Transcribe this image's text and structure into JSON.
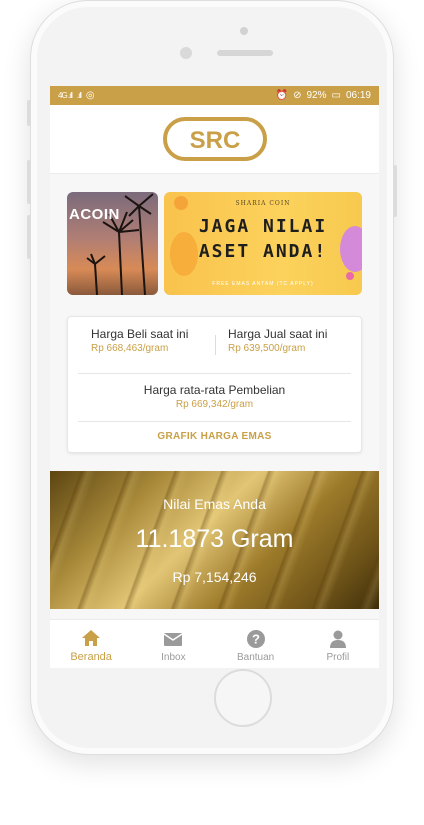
{
  "statusbar": {
    "signal1": "4G .ıll",
    "signal2": ".ıll",
    "battery": "92%",
    "time": "06:19"
  },
  "header": {
    "logo_text": "SRC"
  },
  "banners": {
    "banner1_text": "ACOIN",
    "banner2_small": "SHARIA COIN",
    "banner2_title_line1": "JAGA NILAI",
    "banner2_title_line2": "ASET ANDA!",
    "banner2_footer": "FREE EMAS ANTAM (TC APPLY)"
  },
  "price_card": {
    "buy_label": "Harga Beli saat ini",
    "buy_value": "Rp 668,463/gram",
    "sell_label": "Harga Jual saat ini",
    "sell_value": "Rp 639,500/gram",
    "avg_label": "Harga rata-rata Pembelian",
    "avg_value": "Rp 669,342/gram",
    "chart_link": "GRAFIK HARGA EMAS"
  },
  "gold_summary": {
    "label": "Nilai Emas Anda",
    "amount": "11.1873 Gram",
    "value": "Rp 7,154,246"
  },
  "bottom_nav": {
    "items": [
      {
        "label": "Beranda",
        "icon": "home-icon",
        "active": true
      },
      {
        "label": "Inbox",
        "icon": "mail-icon",
        "active": false
      },
      {
        "label": "Bantuan",
        "icon": "help-icon",
        "active": false
      },
      {
        "label": "Profil",
        "icon": "user-icon",
        "active": false
      }
    ]
  },
  "colors": {
    "accent": "#c9a047",
    "inactive": "#9a9a9a"
  }
}
